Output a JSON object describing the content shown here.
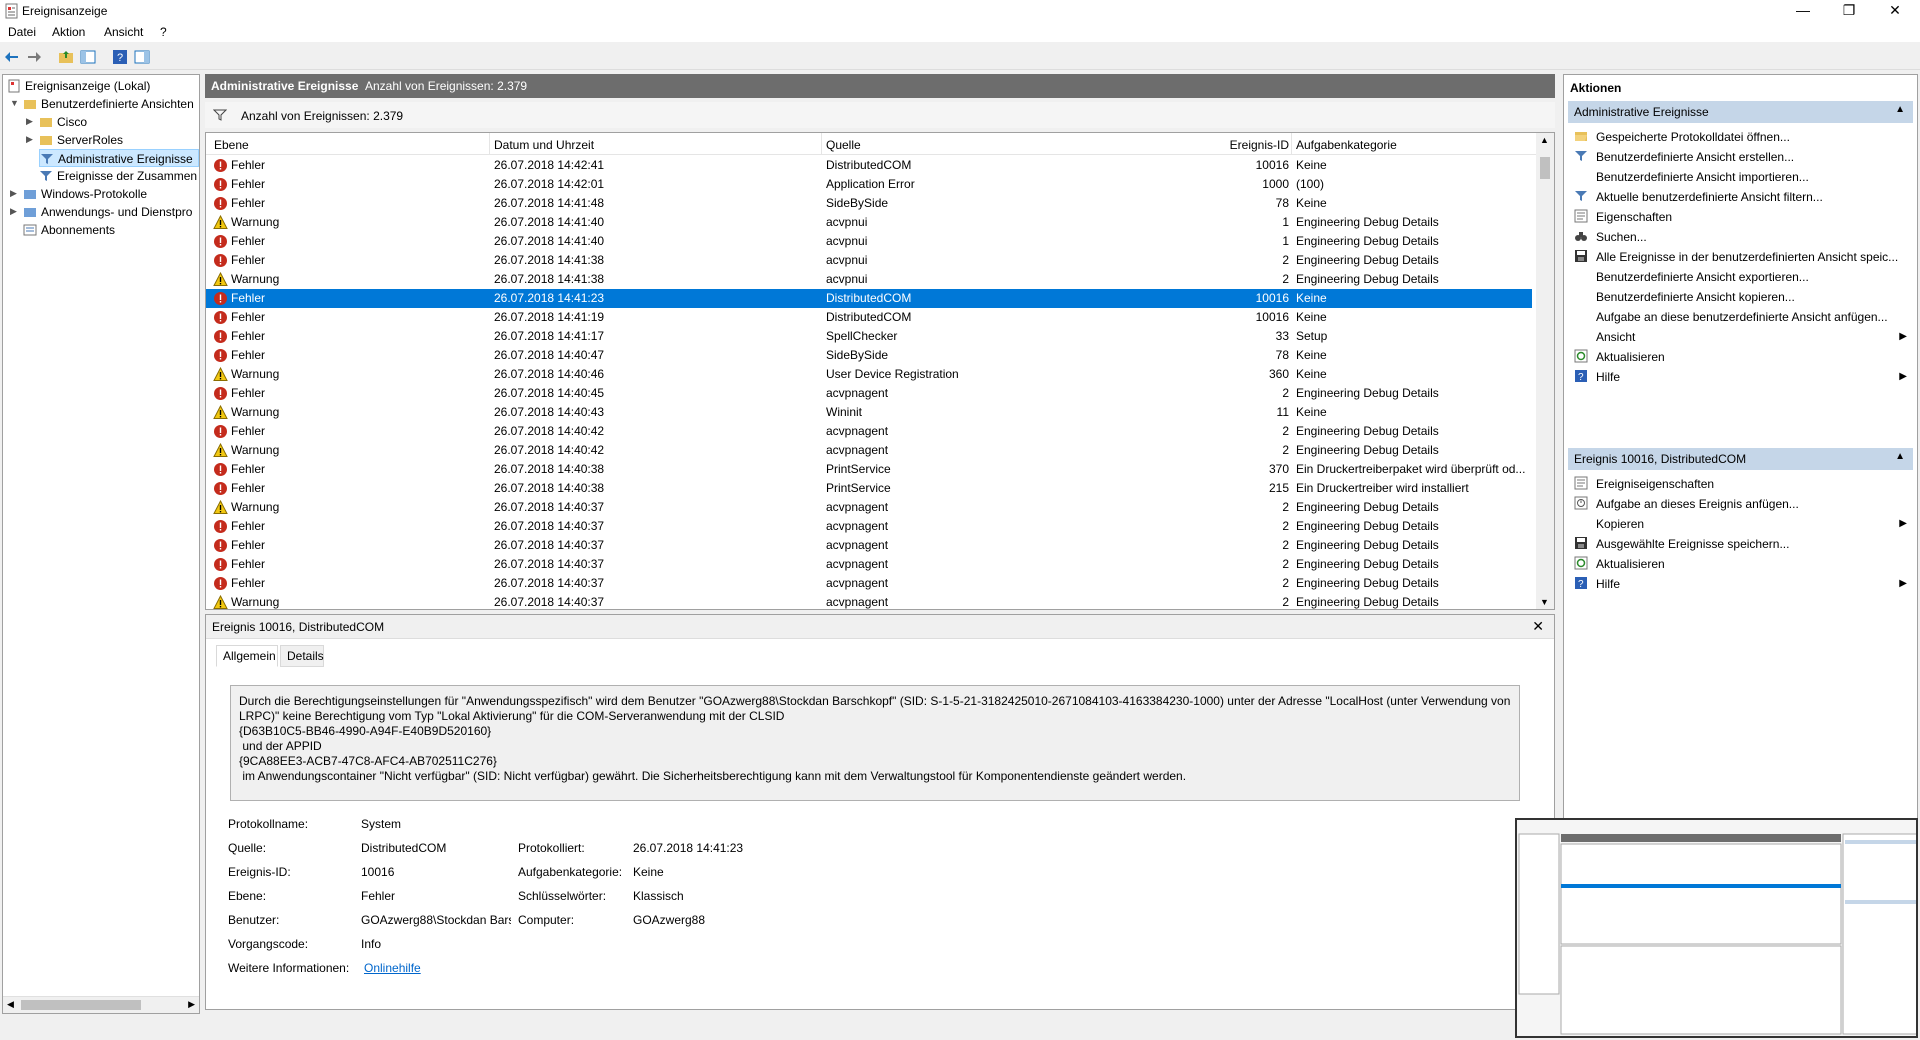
{
  "window": {
    "title": "Ereignisanzeige"
  },
  "menu": [
    "Datei",
    "Aktion",
    "Ansicht",
    "?"
  ],
  "tree": [
    {
      "label": "Ereignisanzeige (Lokal)",
      "level": 0
    },
    {
      "label": "Benutzerdefinierte Ansichten",
      "level": 1
    },
    {
      "label": "Cisco",
      "level": 2
    },
    {
      "label": "ServerRoles",
      "level": 2
    },
    {
      "label": "Administrative Ereignisse",
      "level": 2,
      "selected": true
    },
    {
      "label": "Ereignisse der Zusammen",
      "level": 2
    },
    {
      "label": "Windows-Protokolle",
      "level": 1
    },
    {
      "label": "Anwendungs- und Dienstpro",
      "level": 1
    },
    {
      "label": "Abonnements",
      "level": 1
    }
  ],
  "panel": {
    "title": "Administrative Ereignisse",
    "count": "Anzahl von Ereignissen: 2.379"
  },
  "filter": {
    "text": "Anzahl von Ereignissen: 2.379"
  },
  "columns": [
    "Ebene",
    "Datum und Uhrzeit",
    "Quelle",
    "Ereignis-ID",
    "Aufgabenkategorie"
  ],
  "rows": [
    [
      "Fehler",
      "26.07.2018 14:42:41",
      "DistributedCOM",
      "10016",
      "Keine"
    ],
    [
      "Fehler",
      "26.07.2018 14:42:01",
      "Application Error",
      "1000",
      "(100)"
    ],
    [
      "Fehler",
      "26.07.2018 14:41:48",
      "SideBySide",
      "78",
      "Keine"
    ],
    [
      "Warnung",
      "26.07.2018 14:41:40",
      "acvpnui",
      "1",
      "Engineering Debug Details"
    ],
    [
      "Fehler",
      "26.07.2018 14:41:40",
      "acvpnui",
      "1",
      "Engineering Debug Details"
    ],
    [
      "Fehler",
      "26.07.2018 14:41:38",
      "acvpnui",
      "2",
      "Engineering Debug Details"
    ],
    [
      "Warnung",
      "26.07.2018 14:41:38",
      "acvpnui",
      "2",
      "Engineering Debug Details"
    ],
    [
      "Fehler",
      "26.07.2018 14:41:23",
      "DistributedCOM",
      "10016",
      "Keine"
    ],
    [
      "Fehler",
      "26.07.2018 14:41:19",
      "DistributedCOM",
      "10016",
      "Keine"
    ],
    [
      "Fehler",
      "26.07.2018 14:41:17",
      "SpellChecker",
      "33",
      "Setup"
    ],
    [
      "Fehler",
      "26.07.2018 14:40:47",
      "SideBySide",
      "78",
      "Keine"
    ],
    [
      "Warnung",
      "26.07.2018 14:40:46",
      "User Device Registration",
      "360",
      "Keine"
    ],
    [
      "Fehler",
      "26.07.2018 14:40:45",
      "acvpnagent",
      "2",
      "Engineering Debug Details"
    ],
    [
      "Warnung",
      "26.07.2018 14:40:43",
      "Wininit",
      "11",
      "Keine"
    ],
    [
      "Fehler",
      "26.07.2018 14:40:42",
      "acvpnagent",
      "2",
      "Engineering Debug Details"
    ],
    [
      "Warnung",
      "26.07.2018 14:40:42",
      "acvpnagent",
      "2",
      "Engineering Debug Details"
    ],
    [
      "Fehler",
      "26.07.2018 14:40:38",
      "PrintService",
      "370",
      "Ein Druckertreiberpaket wird überprüft od..."
    ],
    [
      "Fehler",
      "26.07.2018 14:40:38",
      "PrintService",
      "215",
      "Ein Druckertreiber wird installiert"
    ],
    [
      "Warnung",
      "26.07.2018 14:40:37",
      "acvpnagent",
      "2",
      "Engineering Debug Details"
    ],
    [
      "Fehler",
      "26.07.2018 14:40:37",
      "acvpnagent",
      "2",
      "Engineering Debug Details"
    ],
    [
      "Fehler",
      "26.07.2018 14:40:37",
      "acvpnagent",
      "2",
      "Engineering Debug Details"
    ],
    [
      "Fehler",
      "26.07.2018 14:40:37",
      "acvpnagent",
      "2",
      "Engineering Debug Details"
    ],
    [
      "Fehler",
      "26.07.2018 14:40:37",
      "acvpnagent",
      "2",
      "Engineering Debug Details"
    ],
    [
      "Warnung",
      "26.07.2018 14:40:37",
      "acvpnagent",
      "2",
      "Engineering Debug Details"
    ]
  ],
  "selected_row": 7,
  "detail": {
    "title": "Ereignis 10016, DistributedCOM",
    "tabs": [
      "Allgemein",
      "Details"
    ],
    "description": "Durch die Berechtigungseinstellungen für \"Anwendungsspezifisch\" wird dem Benutzer \"GOAzwerg88\\Stockdan Barschkopf\" (SID: S-1-5-21-3182425010-2671084103-4163384230-1000) unter der Adresse \"LocalHost (unter Verwendung von LRPC)\" keine Berechtigung vom Typ \"Lokal Aktivierung\" für die COM-Serveranwendung mit der CLSID\n{D63B10C5-BB46-4990-A94F-E40B9D520160}\n und der APPID\n{9CA88EE3-ACB7-47C8-AFC4-AB702511C276}\n im Anwendungscontainer \"Nicht verfügbar\" (SID: Nicht verfügbar) gewährt. Die Sicherheitsberechtigung kann mit dem Verwaltungstool für Komponentendienste geändert werden.",
    "fields": {
      "protokollname_label": "Protokollname:",
      "protokollname": "System",
      "quelle_label": "Quelle:",
      "quelle": "DistributedCOM",
      "protokolliert_label": "Protokolliert:",
      "protokolliert": "26.07.2018 14:41:23",
      "ereignis_id_label": "Ereignis-ID:",
      "ereignis_id": "10016",
      "aufgabenkategorie_label": "Aufgabenkategorie:",
      "aufgabenkategorie": "Keine",
      "ebene_label": "Ebene:",
      "ebene": "Fehler",
      "schluesselwoerter_label": "Schlüsselwörter:",
      "schluesselwoerter": "Klassisch",
      "benutzer_label": "Benutzer:",
      "benutzer": "GOAzwerg88\\Stockdan Bars",
      "computer_label": "Computer:",
      "computer": "GOAzwerg88",
      "vorgangscode_label": "Vorgangscode:",
      "vorgangscode": "Info",
      "weitere_label": "Weitere Informationen:",
      "weitere_link": "Onlinehilfe"
    }
  },
  "actions": {
    "title": "Aktionen",
    "section1": "Administrative Ereignisse",
    "items1": [
      {
        "label": "Gespeicherte Protokolldatei öffnen...",
        "icon": "folder-open-icon"
      },
      {
        "label": "Benutzerdefinierte Ansicht erstellen...",
        "icon": "filter-icon"
      },
      {
        "label": "Benutzerdefinierte Ansicht importieren...",
        "icon": ""
      },
      {
        "label": "Aktuelle benutzerdefinierte Ansicht filtern...",
        "icon": "filter-icon"
      },
      {
        "label": "Eigenschaften",
        "icon": "properties-icon"
      },
      {
        "label": "Suchen...",
        "icon": "binoculars-icon"
      },
      {
        "label": "Alle Ereignisse in der benutzerdefinierten Ansicht speic...",
        "icon": "save-icon"
      },
      {
        "label": "Benutzerdefinierte Ansicht exportieren...",
        "icon": ""
      },
      {
        "label": "Benutzerdefinierte Ansicht kopieren...",
        "icon": ""
      },
      {
        "label": "Aufgabe an diese benutzerdefinierte Ansicht anfügen...",
        "icon": ""
      },
      {
        "label": "Ansicht",
        "icon": "",
        "submenu": true
      },
      {
        "label": "Aktualisieren",
        "icon": "refresh-icon"
      },
      {
        "label": "Hilfe",
        "icon": "help-icon",
        "submenu": true
      }
    ],
    "section2": "Ereignis 10016, DistributedCOM",
    "items2": [
      {
        "label": "Ereigniseigenschaften",
        "icon": "properties-icon"
      },
      {
        "label": "Aufgabe an dieses Ereignis anfügen...",
        "icon": "task-icon"
      },
      {
        "label": "Kopieren",
        "icon": "",
        "submenu": true
      },
      {
        "label": "Ausgewählte Ereignisse speichern...",
        "icon": "save-icon"
      },
      {
        "label": "Aktualisieren",
        "icon": "refresh-icon"
      },
      {
        "label": "Hilfe",
        "icon": "help-icon",
        "submenu": true
      }
    ]
  },
  "colors": {
    "selection": "#0078d7",
    "section_bg": "#c5d6e8",
    "header_bg": "#6d6d6d",
    "error": "#c42b1c",
    "warning": "#f2c811"
  }
}
